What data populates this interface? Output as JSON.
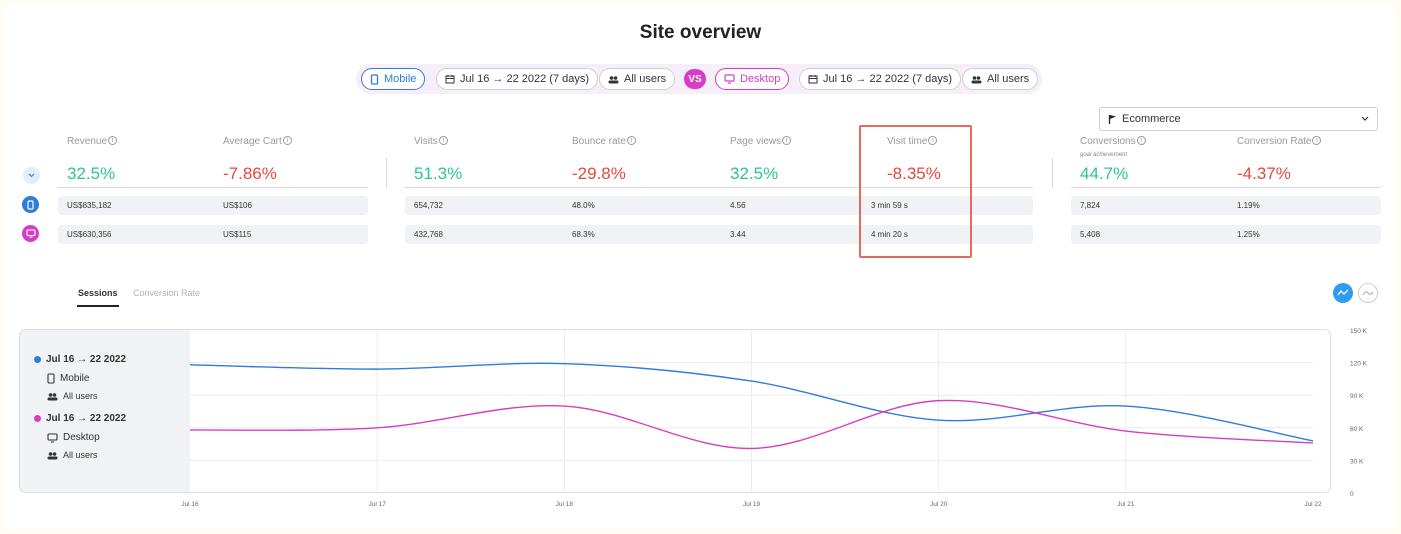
{
  "page_title": "Site overview",
  "filters": {
    "left": {
      "device": "Mobile",
      "date": "Jul 16 → 22 2022 (7 days)",
      "audience": "All users"
    },
    "vs_label": "VS",
    "right": {
      "device": "Desktop",
      "date": "Jul 16 → 22 2022 (7 days)",
      "audience": "All users"
    }
  },
  "goal_select": {
    "value": "Ecommerce"
  },
  "metrics": {
    "revenue": {
      "label": "Revenue",
      "change": "32.5%",
      "mobile": "US$835,182",
      "desktop": "US$630,356"
    },
    "average_cart": {
      "label": "Average Cart",
      "change": "-7.86%",
      "mobile": "US$106",
      "desktop": "US$115"
    },
    "visits": {
      "label": "Visits",
      "change": "51.3%",
      "mobile": "654,732",
      "desktop": "432,768"
    },
    "bounce_rate": {
      "label": "Bounce rate",
      "change": "-29.8%",
      "mobile": "48.0%",
      "desktop": "68.3%"
    },
    "page_views": {
      "label": "Page views",
      "change": "32.5%",
      "mobile": "4.56",
      "desktop": "3.44"
    },
    "visit_time": {
      "label": "Visit time",
      "change": "-8.35%",
      "mobile": "3 min 59 s",
      "desktop": "4 min 20 s"
    },
    "conversions": {
      "label": "Conversions",
      "sublabel": "goal achievement",
      "change": "44.7%",
      "mobile": "7,824",
      "desktop": "5,408"
    },
    "conversion_rate": {
      "label": "Conversion Rate",
      "change": "-4.37%",
      "mobile": "1.19%",
      "desktop": "1.25%"
    }
  },
  "tabs": [
    "Sessions",
    "Conversion Rate"
  ],
  "legend": {
    "series1": {
      "date": "Jul 16 → 22 2022",
      "device": "Mobile",
      "audience": "All users"
    },
    "series2": {
      "date": "Jul 16 → 22 2022",
      "device": "Desktop",
      "audience": "All users"
    }
  },
  "colors": {
    "mobile": "#2e7cdc",
    "desktop": "#d63dc6",
    "positive": "#2dc58f",
    "negative": "#e8473c",
    "highlight": "#e8675e"
  },
  "chart_data": {
    "type": "line",
    "x": [
      "Jul 16",
      "Jul 17",
      "Jul 18",
      "Jul 19",
      "Jul 20",
      "Jul 21",
      "Jul 22"
    ],
    "y_ticks": [
      "0",
      "30 K",
      "60 K",
      "90 K",
      "120 K",
      "150 K"
    ],
    "ylim": [
      0,
      150000
    ],
    "grid": true,
    "series": [
      {
        "values": [
          118000,
          114000,
          119000,
          103000,
          67000,
          80000,
          48000
        ]
      },
      {
        "values": [
          58000,
          60000,
          80000,
          41000,
          85000,
          57000,
          46000
        ]
      }
    ]
  }
}
